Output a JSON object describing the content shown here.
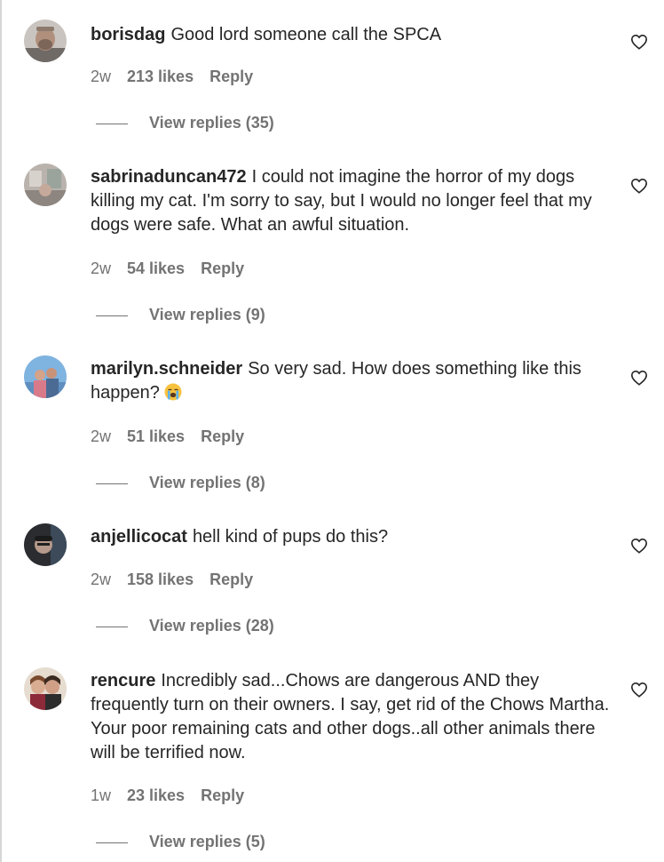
{
  "comments": [
    {
      "username": "borisdag",
      "text": "Good lord someone call the SPCA",
      "time": "2w",
      "likes": "213 likes",
      "reply": "Reply",
      "view_replies": "View replies (35)"
    },
    {
      "username": "sabrinaduncan472",
      "text": "I could not imagine the horror of my dogs killing my cat. I'm sorry to say, but I would no longer feel that my dogs were safe. What an awful situation.",
      "time": "2w",
      "likes": "54 likes",
      "reply": "Reply",
      "view_replies": "View replies (9)"
    },
    {
      "username": "marilyn.schneider",
      "text": "So very sad. How does something like this happen?",
      "time": "2w",
      "likes": "51 likes",
      "reply": "Reply",
      "view_replies": "View replies (8)"
    },
    {
      "username": "anjellicocat",
      "text": "hell kind of pups do this?",
      "time": "2w",
      "likes": "158 likes",
      "reply": "Reply",
      "view_replies": "View replies (28)"
    },
    {
      "username": "rencure",
      "text": "Incredibly sad...Chows are dangerous AND they frequently turn on their owners. I say, get rid of the Chows Martha. Your poor remaining cats and other dogs..all other animals there will be terrified now.",
      "time": "1w",
      "likes": "23 likes",
      "reply": "Reply",
      "view_replies": "View replies (5)"
    }
  ],
  "icons": {
    "like": "heart-outline-icon",
    "emoji": "loudly-crying-face-emoji"
  },
  "colors": {
    "text": "#262626",
    "secondary": "#737373"
  }
}
